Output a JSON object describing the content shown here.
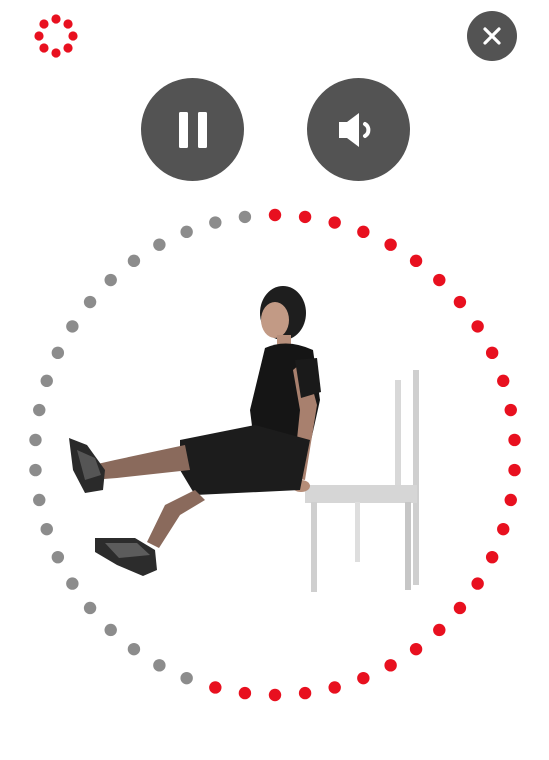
{
  "loader": {
    "icon": "loading-dots-icon",
    "dot_count": 8,
    "color": "#e8101f"
  },
  "controls": {
    "close": {
      "icon": "close-icon"
    },
    "pause": {
      "icon": "pause-icon"
    },
    "sound": {
      "icon": "speaker-icon"
    },
    "button_color": "#535353"
  },
  "progress": {
    "total_dots": 50,
    "completed_fraction": 0.55,
    "completed_color": "#e8101f",
    "remaining_color": "#8c8c8c"
  },
  "exercise": {
    "illustration": "seated-leg-raise-with-chair-image"
  }
}
